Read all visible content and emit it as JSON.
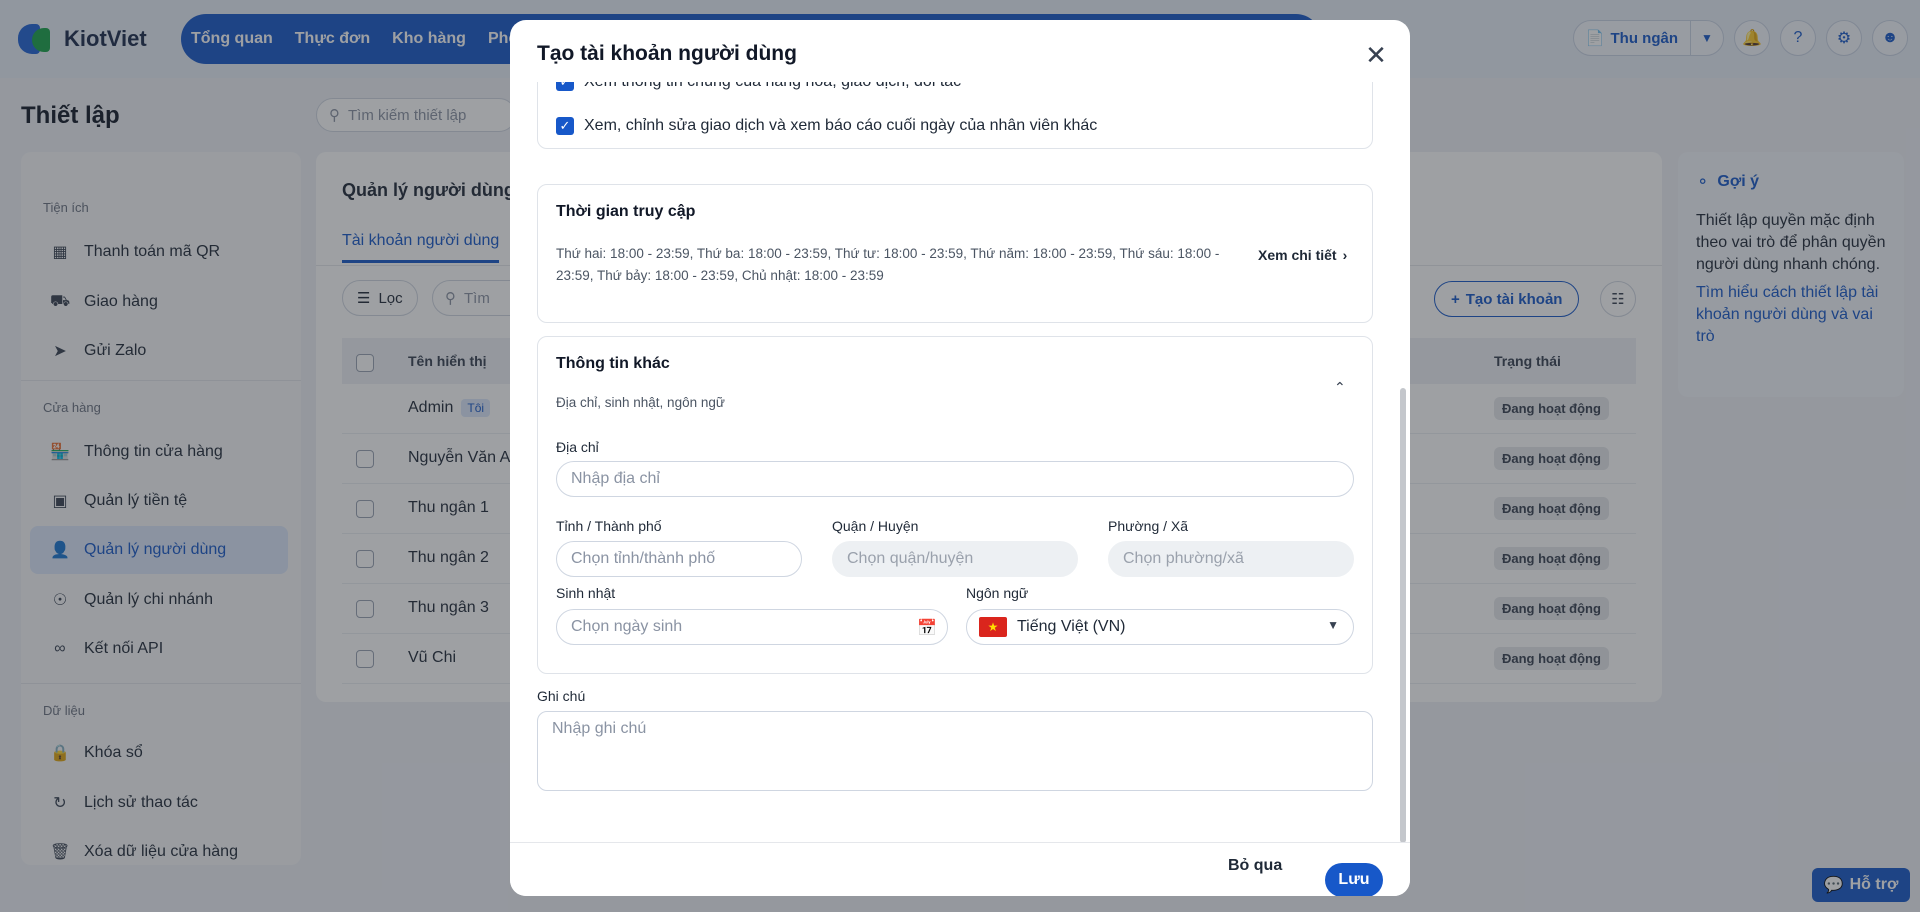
{
  "app": {
    "brand": "KiotViet"
  },
  "topnav": {
    "items": [
      "Tổng quan",
      "Thực đơn",
      "Kho hàng",
      "Phò"
    ]
  },
  "topright": {
    "cashier_label": "Thu ngân"
  },
  "page": {
    "title": "Thiết lập",
    "search_placeholder": "Tìm kiếm thiết lập"
  },
  "sidebar": {
    "groups": [
      {
        "label": "Tiện ích",
        "items": [
          {
            "label": "Thanh toán mã QR",
            "icon": "qr-icon"
          },
          {
            "label": "Giao hàng",
            "icon": "truck-icon"
          },
          {
            "label": "Gửi Zalo",
            "icon": "send-icon"
          }
        ]
      },
      {
        "label": "Cửa hàng",
        "items": [
          {
            "label": "Thông tin cửa hàng",
            "icon": "store-icon"
          },
          {
            "label": "Quản lý tiền tệ",
            "icon": "money-icon"
          },
          {
            "label": "Quản lý người dùng",
            "icon": "user-doc-icon",
            "active": true
          },
          {
            "label": "Quản lý chi nhánh",
            "icon": "pin-icon"
          },
          {
            "label": "Kết nối API",
            "icon": "link-icon"
          }
        ]
      },
      {
        "label": "Dữ liệu",
        "items": [
          {
            "label": "Khóa sổ",
            "icon": "lock-icon"
          },
          {
            "label": "Lịch sử thao tác",
            "icon": "history-icon"
          },
          {
            "label": "Xóa dữ liệu cửa hàng",
            "icon": "trash-icon"
          }
        ]
      }
    ]
  },
  "content": {
    "title": "Quản lý người dùng",
    "tab": "Tài khoản người dùng",
    "filter_label": "Lọc",
    "search_placeholder": "Tìm",
    "create_label": "Tạo tài khoản",
    "columns": {
      "name": "Tên hiển thị",
      "status": "Trạng thái"
    },
    "me_badge": "Tôi",
    "rows": [
      {
        "name": "Admin",
        "status": "Đang hoạt động",
        "me": true
      },
      {
        "name": "Nguyễn Văn A",
        "status": "Đang hoạt động"
      },
      {
        "name": "Thu ngân 1",
        "status": "Đang hoạt động"
      },
      {
        "name": "Thu ngân 2",
        "status": "Đang hoạt động"
      },
      {
        "name": "Thu ngân 3",
        "status": "Đang hoạt động"
      },
      {
        "name": "Vũ Chi",
        "status": "Đang hoạt động"
      }
    ]
  },
  "hint": {
    "title": "Gợi ý",
    "body": "Thiết lập quyền mặc định theo vai trò để phân quyền người dùng nhanh chóng.",
    "link": "Tìm hiểu cách thiết lập tài khoản người dùng và vai trò"
  },
  "support": {
    "label": "Hỗ trợ"
  },
  "modal": {
    "title": "Tạo tài khoản người dùng",
    "permissions": [
      {
        "label": "Xem thông tin chung của hàng hóa, giao dịch, đối tác",
        "checked": true
      },
      {
        "label": "Xem, chỉnh sửa giao dịch và xem báo cáo cuối ngày của nhân viên khác",
        "checked": true
      }
    ],
    "access": {
      "title": "Thời gian truy cập",
      "text": "Thứ hai: 18:00 - 23:59, Thứ ba: 18:00 - 23:59, Thứ tư: 18:00 - 23:59, Thứ năm: 18:00 - 23:59, Thứ sáu: 18:00 - 23:59, Thứ bảy: 18:00 - 23:59, Chủ nhật: 18:00 - 23:59",
      "detail_link": "Xem chi tiết"
    },
    "other": {
      "title": "Thông tin khác",
      "subtitle": "Địa chỉ, sinh nhật, ngôn ngữ",
      "address_label": "Địa chỉ",
      "address_placeholder": "Nhập địa chỉ",
      "province_label": "Tỉnh / Thành phố",
      "province_placeholder": "Chọn tỉnh/thành phố",
      "district_label": "Quận / Huyện",
      "district_placeholder": "Chọn quận/huyện",
      "ward_label": "Phường / Xã",
      "ward_placeholder": "Chọn phường/xã",
      "birthday_label": "Sinh nhật",
      "birthday_placeholder": "Chọn ngày sinh",
      "language_label": "Ngôn ngữ",
      "language_value": "Tiếng Việt (VN)"
    },
    "note": {
      "label": "Ghi chú",
      "placeholder": "Nhập ghi chú"
    },
    "footer": {
      "cancel": "Bỏ qua",
      "save": "Lưu"
    }
  },
  "colors": {
    "primary": "#1758c9",
    "success": "#18a34a",
    "overlay": "rgba(40,44,52,0.45)"
  }
}
